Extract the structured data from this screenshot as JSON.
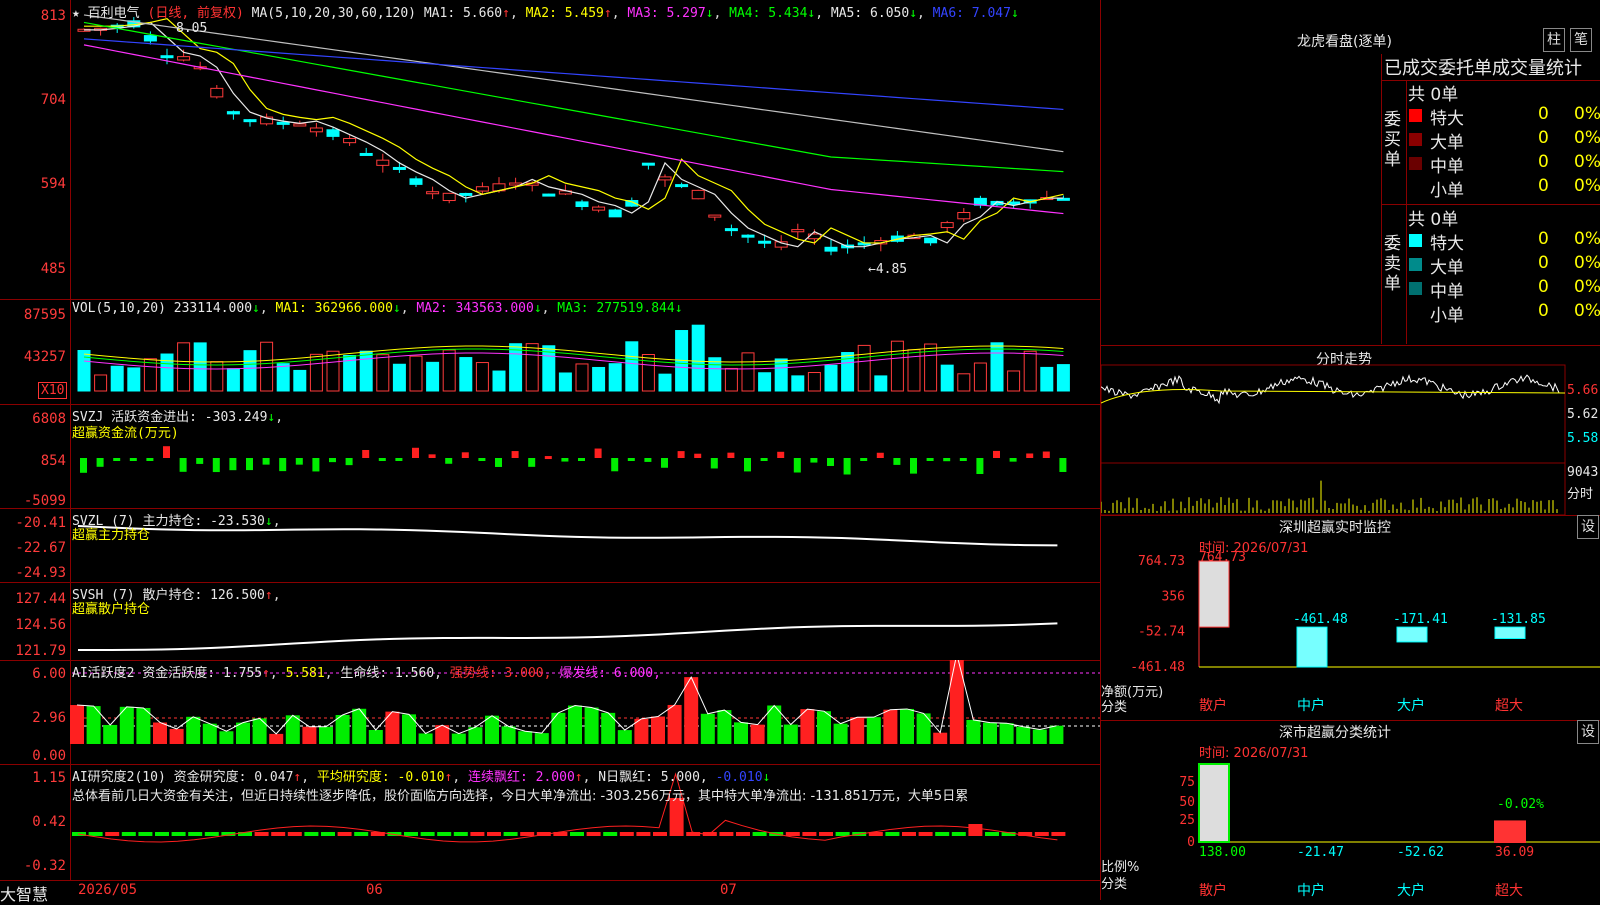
{
  "app": {
    "brand": "大智慧"
  },
  "main": {
    "stock": "百利电气",
    "mode": "(日线, 前复权)",
    "ma_label": "MA(5,10,20,30,60,120)",
    "ma": [
      "MA1: 5.660",
      "MA2: 5.459",
      "MA3: 5.297",
      "MA4: 5.434",
      "MA5: 6.050",
      "MA6: 7.047"
    ],
    "y_ticks": [
      "813",
      "704",
      "594",
      "485"
    ],
    "high_label": "8.05",
    "low_label": "←4.85"
  },
  "vol": {
    "label": "VOL(5,10,20)",
    "value": "233114.000",
    "ma": [
      "MA1: 362966.000",
      "MA2: 343563.000",
      "MA3: 277519.844"
    ],
    "y_ticks": [
      "87595",
      "43257"
    ],
    "unit": "X10"
  },
  "svzj": {
    "label": "SVZJ  活跃资金进出: -303.249",
    "sub": "超赢资金流(万元)",
    "y_ticks": [
      "6808",
      "854",
      "-5099"
    ]
  },
  "svzl": {
    "label": "SVZL (7) 主力持仓: -23.530",
    "sub": "超赢主力持仓",
    "y_ticks": [
      "-20.41",
      "-22.67",
      "-24.93"
    ]
  },
  "svsh": {
    "label": "SVSH (7) 散户持仓: 126.500",
    "sub": "超赢散户持仓",
    "y_ticks": [
      "127.44",
      "124.56",
      "121.79"
    ]
  },
  "ai1": {
    "label": "AI活跃度2 资金活跃度: 1.755",
    "v2": "5.581",
    "life": "生命线: 1.560,",
    "strong": "强势线: 3.000,",
    "burst": "爆发线: 6.000,",
    "y_ticks": [
      "6.00",
      "2.96",
      "0.00"
    ]
  },
  "ai2": {
    "label": "AI研究度2(10) 资金研究度: 0.047",
    "avg": "平均研究度: -0.010",
    "red": "连续飘红: 2.000",
    "nday": "N日飘红: 5.000,",
    "neg": "-0.010",
    "summary": "总体看前几日大资金有关注，但近日持续性逐步降低，股价面临方向选择，今日大单净流出: -303.256万元，其中特大单净流出: -131.851万元，大单5日累",
    "y_ticks": [
      "1.15",
      "0.42",
      "-0.32"
    ]
  },
  "xaxis": [
    "2026/05",
    "06",
    "07"
  ],
  "dragon": {
    "title": "龙虎看盘(逐单)",
    "btn1": "柱",
    "btn2": "笔",
    "subtitle": "已成交委托单成交量统计",
    "buy": {
      "side": "委买单",
      "total": "共 0单",
      "rows": [
        [
          "特大",
          "0",
          "0%"
        ],
        [
          "大单",
          "0",
          "0%"
        ],
        [
          "中单",
          "0",
          "0%"
        ],
        [
          "小单",
          "0",
          "0%"
        ]
      ]
    },
    "sell": {
      "side": "委卖单",
      "total": "共 0单",
      "rows": [
        [
          "特大",
          "0",
          "0%"
        ],
        [
          "大单",
          "0",
          "0%"
        ],
        [
          "中单",
          "0",
          "0%"
        ],
        [
          "小单",
          "0",
          "0%"
        ]
      ]
    }
  },
  "intraday": {
    "title": "分时走势",
    "ticks": [
      "5.66",
      "5.62",
      "5.58"
    ],
    "vol": "9043",
    "vol_unit": "分时"
  },
  "monitor": {
    "title": "深圳超赢实时监控",
    "set": "设",
    "time": "时间: 2026/07/31",
    "y_ticks": [
      "764.73",
      "356",
      "-52.74",
      "-461.48"
    ],
    "ylab1": "净额(万元)",
    "ylab2": "分类",
    "cats": [
      "散户",
      "中户",
      "大户",
      "超大"
    ],
    "values": [
      "764.73",
      "-461.48",
      "-171.41",
      "-131.85"
    ]
  },
  "classify": {
    "title": "深市超赢分类统计",
    "set": "设",
    "time": "时间: 2026/07/31",
    "y_ticks": [
      "75",
      "50",
      "25",
      "0"
    ],
    "ylab1": "比例%",
    "ylab2": "分类",
    "cats": [
      "散户",
      "中户",
      "大户",
      "超大"
    ],
    "values": [
      "138.00",
      "-21.47",
      "-52.62",
      "36.09"
    ],
    "pct": "-0.02%"
  },
  "chart_data": {
    "type": "bar",
    "title": "深圳超赢实时监控",
    "categories": [
      "散户",
      "中户",
      "大户",
      "超大"
    ],
    "values": [
      764.73,
      -461.48,
      -171.41,
      -131.85
    ],
    "ylim": [
      -461.48,
      764.73
    ],
    "ylabel": "净额(万元)"
  }
}
